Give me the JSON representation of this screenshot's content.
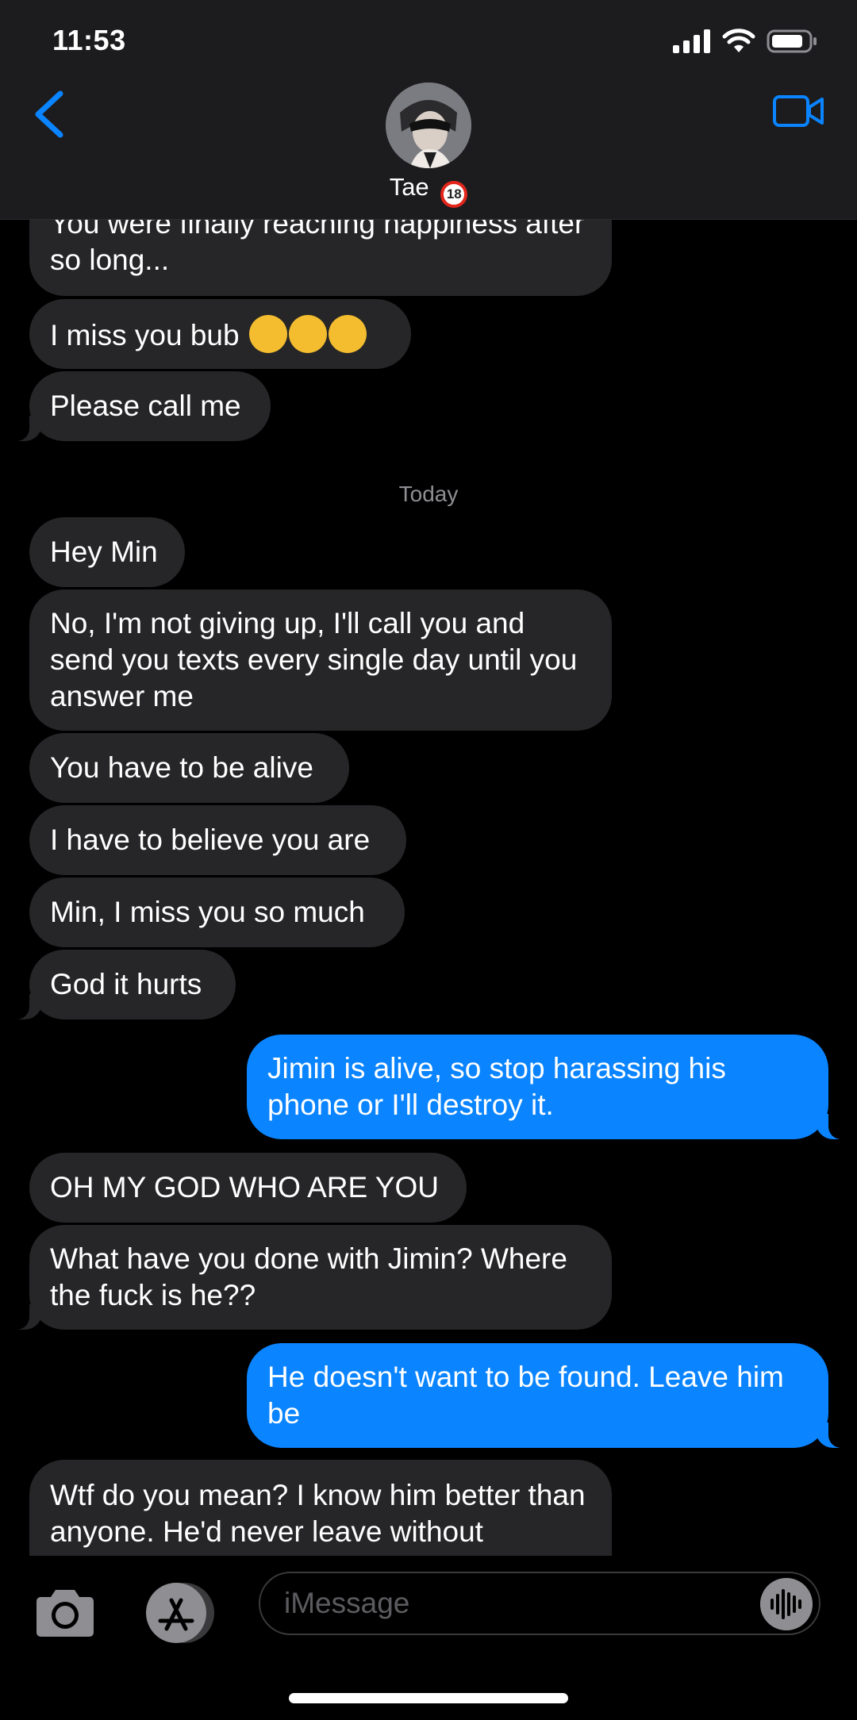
{
  "status_bar": {
    "time": "11:53"
  },
  "header": {
    "contact_name": "Tae",
    "contact_badge": "18"
  },
  "thread": {
    "messages_before": [
      {
        "text": "You were finally reaching happiness after so long...",
        "direction": "incoming"
      },
      {
        "text": "I miss you bub",
        "direction": "incoming",
        "emoji": [
          "pensive-face",
          "pensive-face",
          "pensive-face"
        ]
      },
      {
        "text": "Please call me",
        "direction": "incoming"
      }
    ],
    "day_separator": "Today",
    "messages_today": [
      {
        "text": "Hey Min",
        "direction": "incoming"
      },
      {
        "text": "No, I'm not giving up, I'll call you and send you texts every single day until you answer me",
        "direction": "incoming"
      },
      {
        "text": "You have to be alive",
        "direction": "incoming"
      },
      {
        "text": "I have to believe you are",
        "direction": "incoming"
      },
      {
        "text": "Min, I miss you so much",
        "direction": "incoming"
      },
      {
        "text": "God it hurts",
        "direction": "incoming"
      },
      {
        "text": "Jimin is alive, so stop harassing his phone or I'll destroy it.",
        "direction": "outgoing"
      },
      {
        "text": "OH MY GOD WHO ARE YOU",
        "direction": "incoming"
      },
      {
        "text": "What have you done with Jimin? Where the fuck is he??",
        "direction": "incoming"
      },
      {
        "text": "He doesn't want to be found. Leave him be",
        "direction": "outgoing"
      },
      {
        "text": "Wtf do you mean? I know him better than anyone. He'd never leave without",
        "direction": "incoming"
      }
    ]
  },
  "composer": {
    "placeholder": "iMessage"
  },
  "colors": {
    "outgoing_bubble": "#0a84ff",
    "incoming_bubble": "#262628",
    "accent": "#0a84ff"
  }
}
